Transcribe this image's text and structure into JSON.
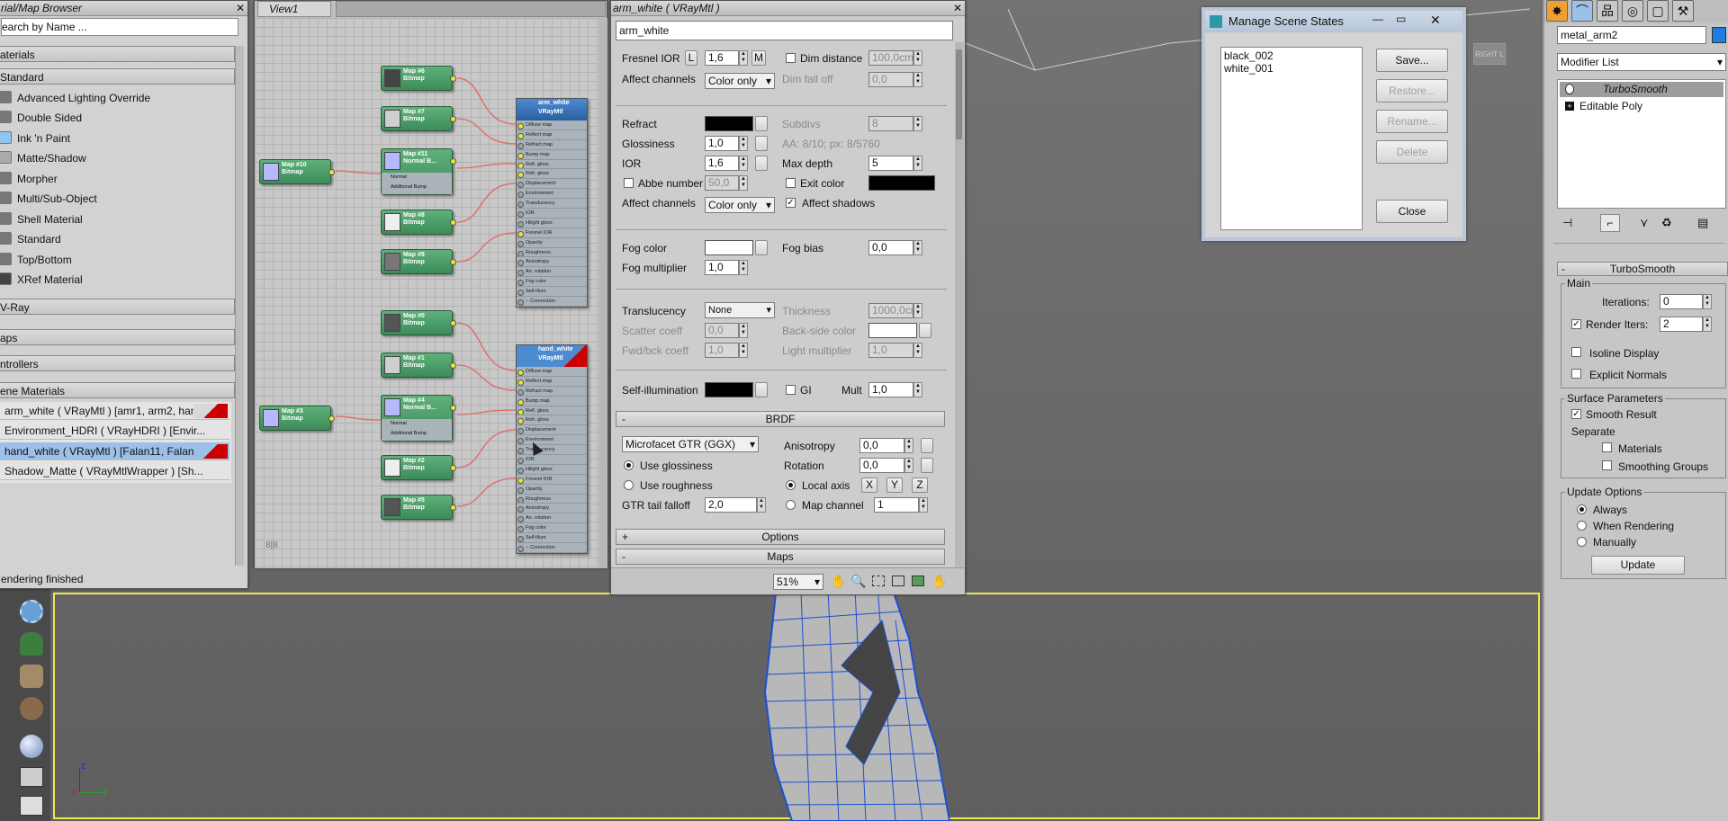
{
  "viewport": {
    "right_label": "RIGHT L",
    "axis": {
      "z": "z",
      "x": "x",
      "y": "y"
    }
  },
  "browser": {
    "title": "rial/Map Browser",
    "search_placeholder": "earch by Name ...",
    "sections": {
      "materials": "aterials",
      "standard": "Standard",
      "vray": "V-Ray",
      "maps": "aps",
      "controllers": "ntrollers",
      "scene_materials": "ene Materials"
    },
    "standard_items": [
      "Advanced Lighting Override",
      "Double Sided",
      "Ink 'n Paint",
      "Matte/Shadow",
      "Morpher",
      "Multi/Sub-Object",
      "Shell Material",
      "Standard",
      "Top/Bottom",
      "XRef Material"
    ],
    "scene_items": [
      "arm_white ( VRayMtl ) [amr1, arm2, han",
      "Environment_HDRI ( VRayHDRI ) [Envir...",
      "hand_white ( VRayMtl ) [Falan11, Falan",
      "Shadow_Matte ( VRayMtlWrapper ) [Sh..."
    ],
    "status": "endering finished"
  },
  "view": {
    "tab": "View1",
    "nav_label": "8|8",
    "zoom": "51%",
    "nodes_top": [
      {
        "name": "Map #6",
        "type": "Bitmap"
      },
      {
        "name": "Map #7",
        "type": "Bitmap"
      },
      {
        "name": "Map #11",
        "type": "Normal B..."
      },
      {
        "name": "Map #8",
        "type": "Bitmap"
      },
      {
        "name": "Map #9",
        "type": "Bitmap"
      }
    ],
    "nodes_bottom": [
      {
        "name": "Map #0",
        "type": "Bitmap"
      },
      {
        "name": "Map #1",
        "type": "Bitmap"
      },
      {
        "name": "Map #4",
        "type": "Normal B..."
      },
      {
        "name": "Map #2",
        "type": "Bitmap"
      },
      {
        "name": "Map #5",
        "type": "Bitmap"
      }
    ],
    "left_top": {
      "name": "Map #10",
      "type": "Bitmap"
    },
    "left_bottom": {
      "name": "Map #3",
      "type": "Bitmap"
    },
    "normal_slots": [
      "Normal",
      "Additional Bump"
    ],
    "mtl_top": {
      "name": "arm_white",
      "type": "VRayMtl"
    },
    "mtl_bottom": {
      "name": "hand_white",
      "type": "VRayMtl"
    },
    "slots": [
      "Diffuse map",
      "Reflect map",
      "Refract map",
      "Bump map",
      "Refl. gloss",
      "Refr. gloss",
      "Displacement",
      "Environment",
      "Translucency",
      "IOR",
      "Hilight gloss",
      "Fresnel IOR",
      "Opacity",
      "Roughness",
      "Anisotropy",
      "An. rotation",
      "Fog color",
      "Self-illum",
      "-- Connection"
    ]
  },
  "params": {
    "title": "arm_white ( VRayMtl )",
    "name_field": "arm_white",
    "fresnel_ior_label": "Fresnel IOR",
    "fresnel_l": "L",
    "fresnel_ior": "1,6",
    "fresnel_m": "M",
    "dim_distance_label": "Dim distance",
    "dim_distance": "100,0cm",
    "affect_channels_label": "Affect channels",
    "affect_channels": "Color only",
    "dim_falloff_label": "Dim fall off",
    "dim_falloff": "0,0",
    "refract_label": "Refract",
    "subdivs_label": "Subdivs",
    "subdivs": "8",
    "glossiness_label": "Glossiness",
    "glossiness": "1,0",
    "aa_label": "AA: 8/10; px: 8/5760",
    "ior_label": "IOR",
    "ior": "1,6",
    "max_depth_label": "Max depth",
    "max_depth": "5",
    "abbe_label": "Abbe number",
    "abbe": "50,0",
    "exit_color_label": "Exit color",
    "affect_channels2": "Color only",
    "affect_shadows_label": "Affect shadows",
    "fog_color_label": "Fog color",
    "fog_bias_label": "Fog bias",
    "fog_bias": "0,0",
    "fog_mult_label": "Fog multiplier",
    "fog_mult": "1,0",
    "translucency_label": "Translucency",
    "translucency": "None",
    "thickness_label": "Thickness",
    "thickness": "1000,0cm",
    "scatter_label": "Scatter coeff",
    "scatter": "0,0",
    "backside_label": "Back-side color",
    "fwdbck_label": "Fwd/bck coeff",
    "fwdbck": "1,0",
    "lightmult_label": "Light multiplier",
    "lightmult": "1,0",
    "selfillum_label": "Self-illumination",
    "gi_label": "GI",
    "mult_label": "Mult",
    "mult": "1,0",
    "brdf_title": "BRDF",
    "brdf_type": "Microfacet GTR (GGX)",
    "anisotropy_label": "Anisotropy",
    "anisotropy": "0,0",
    "rotation_label": "Rotation",
    "rotation": "0,0",
    "use_gloss_label": "Use glossiness",
    "use_rough_label": "Use roughness",
    "local_axis_label": "Local axis",
    "axes": [
      "X",
      "Y",
      "Z"
    ],
    "gtr_label": "GTR tail falloff",
    "gtr": "2,0",
    "map_channel_label": "Map channel",
    "map_channel": "1",
    "options_title": "Options",
    "maps_title": "Maps",
    "collapse_minus": "-",
    "expand_plus": "+"
  },
  "states": {
    "title": "Manage Scene States",
    "items": [
      "black_002",
      "white_001"
    ],
    "save": "Save...",
    "restore": "Restore...",
    "rename": "Rename...",
    "delete": "Delete",
    "close": "Close"
  },
  "modify": {
    "object_name": "metal_arm2",
    "modifier_list": "Modifier List",
    "stack": [
      "TurboSmooth",
      "Editable Poly"
    ],
    "rollout_title": "TurboSmooth",
    "main_group": "Main",
    "iterations_label": "Iterations:",
    "iterations": "0",
    "render_iters_label": "Render Iters:",
    "render_iters": "2",
    "isoline_label": "Isoline Display",
    "explicit_label": "Explicit Normals",
    "surface_group": "Surface Parameters",
    "smooth_result_label": "Smooth Result",
    "separate_label": "Separate",
    "materials_label": "Materials",
    "smoothing_label": "Smoothing Groups",
    "update_group": "Update Options",
    "always_label": "Always",
    "when_rendering_label": "When Rendering",
    "manually_label": "Manually",
    "update_button": "Update"
  }
}
